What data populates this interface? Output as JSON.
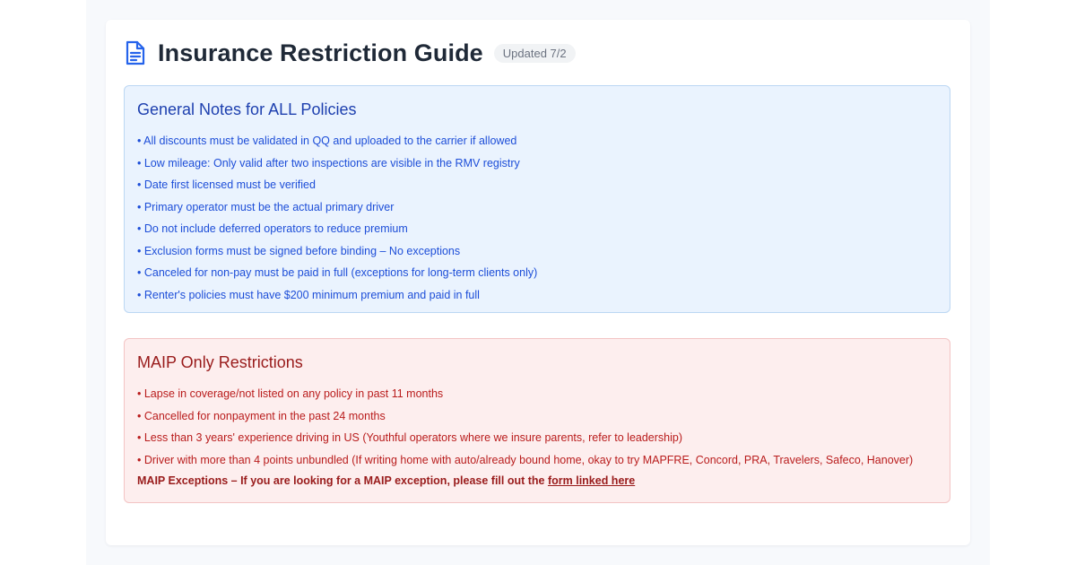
{
  "header": {
    "title": "Insurance Restriction Guide",
    "badge": "Updated 7/2",
    "icon": "document-icon",
    "accent_color": "#2563eb"
  },
  "general": {
    "title": "General Notes for ALL Policies",
    "items": [
      "• All discounts must be validated in QQ and uploaded to the carrier if allowed",
      "• Low mileage: Only valid after two inspections are visible in the RMV registry",
      "• Date first licensed must be verified",
      "• Primary operator must be the actual primary driver",
      "• Do not include deferred operators to reduce premium",
      "• Exclusion forms must be signed before binding – No exceptions",
      "• Canceled for non-pay must be paid in full (exceptions for long-term clients only)",
      "• Renter's policies must have $200 minimum premium and paid in full"
    ],
    "colors": {
      "background": "#eaf3fe",
      "text": "#1d4ed8"
    }
  },
  "maip": {
    "title": "MAIP Only Restrictions",
    "items": [
      "• Lapse in coverage/not listed on any policy in past 11 months",
      "• Cancelled for nonpayment in the past 24 months",
      "• Less than 3 years' experience driving in US (Youthful operators where we insure parents, refer to leadership)",
      "• Driver with more than 4 points unbundled (If writing home with auto/already bound home, okay to try MAPFRE, Concord, PRA, Travelers, Safeco, Hanover)"
    ],
    "exception_text": "MAIP Exceptions – If you are looking for a MAIP exception, please fill out the ",
    "exception_link": "form linked here",
    "colors": {
      "background": "#fdeeee",
      "text": "#b91c1c"
    }
  }
}
